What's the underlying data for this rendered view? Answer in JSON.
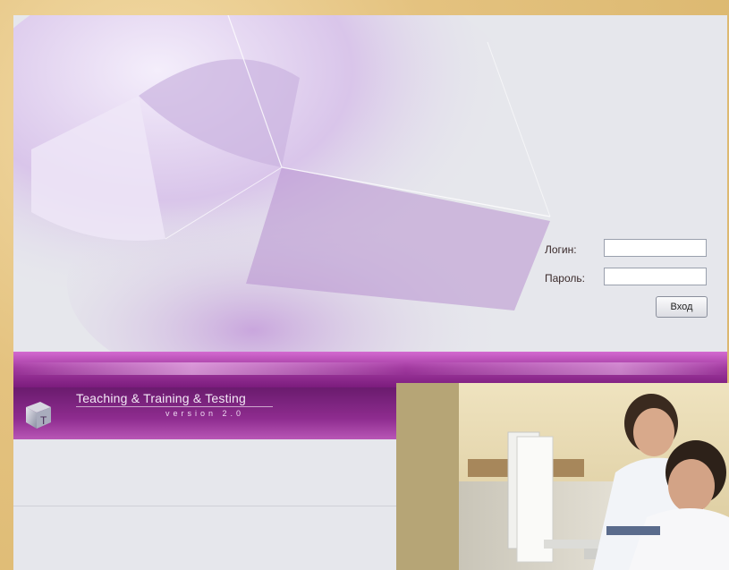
{
  "login": {
    "login_label": "Логин:",
    "password_label": "Пароль:",
    "login_value": "",
    "password_value": "",
    "submit_label": "Вход"
  },
  "brand": {
    "title": "Teaching & Training & Testing",
    "version": "version 2.0",
    "logo_letter": "T"
  },
  "photo": {
    "icon": "students-at-computers-photo"
  }
}
